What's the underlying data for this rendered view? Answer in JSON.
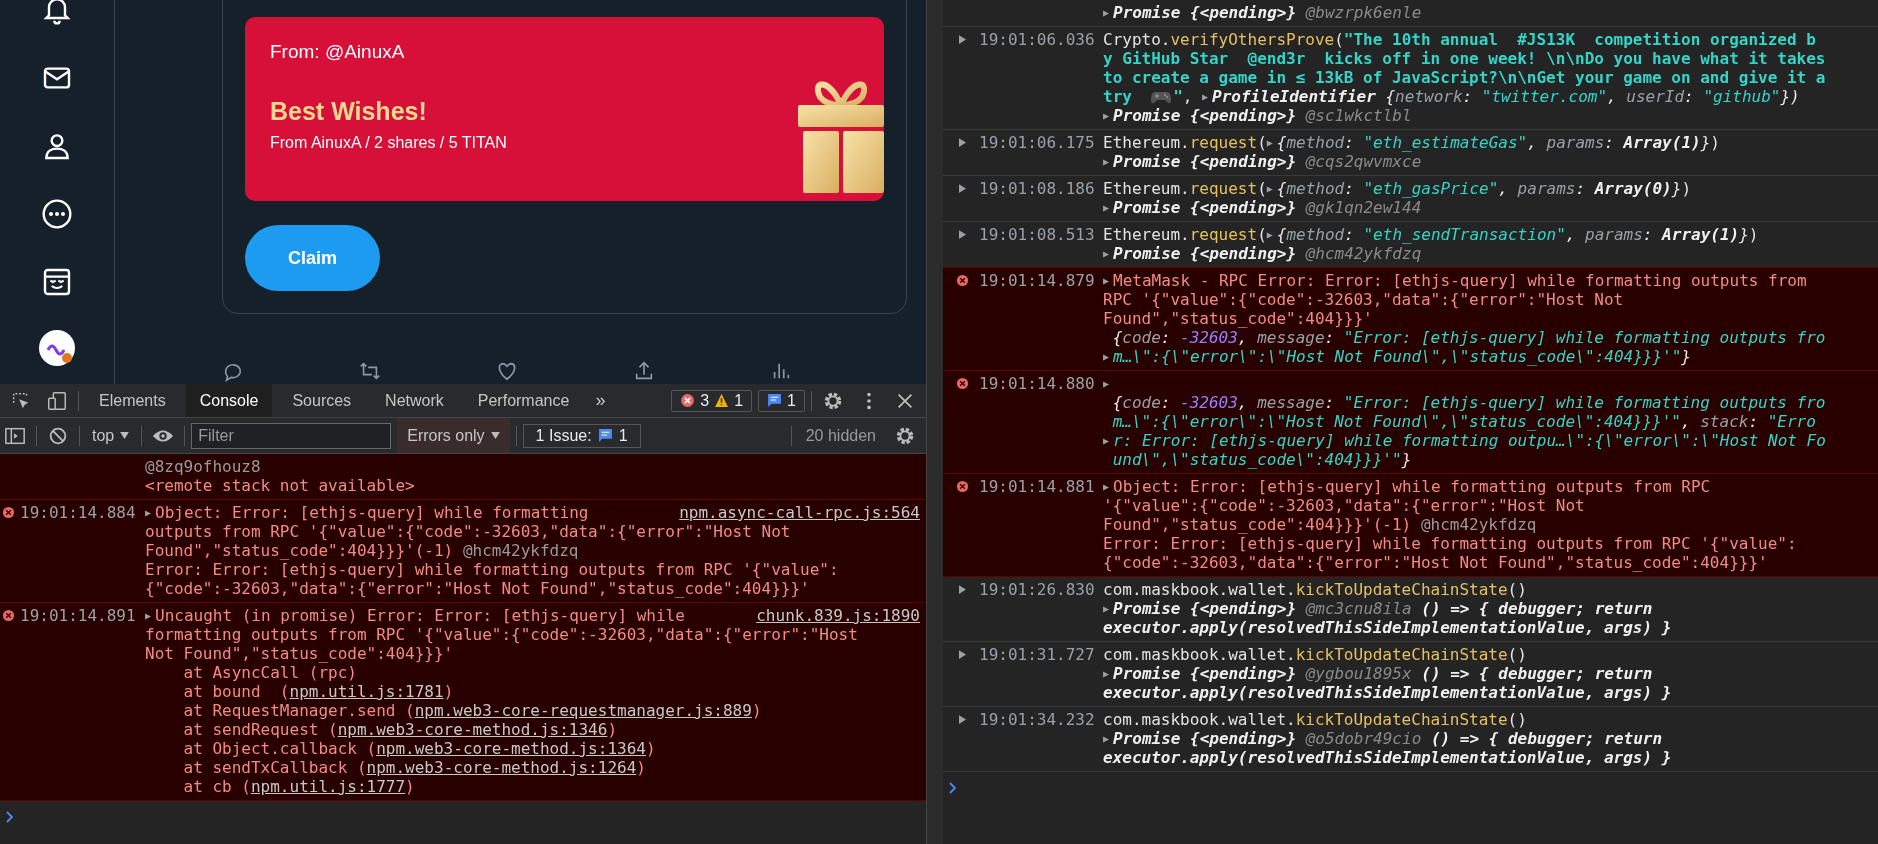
{
  "tweet_card": {
    "from": "From: @AinuxA",
    "title": "Best Wishes!",
    "subtitle": "From AinuxA / 2 shares / 5 TITAN",
    "button": "Claim"
  },
  "devtools": {
    "tabs": [
      {
        "label": "Elements",
        "selected": false
      },
      {
        "label": "Console",
        "selected": true
      },
      {
        "label": "Sources",
        "selected": false
      },
      {
        "label": "Network",
        "selected": false
      },
      {
        "label": "Performance",
        "selected": false
      }
    ],
    "more": "»",
    "errors": "3",
    "warnings": "1",
    "messages": "1"
  },
  "filter_bar": {
    "context": "top",
    "placeholder": "Filter",
    "levels": "Errors only",
    "issues_label": "1 Issue:",
    "issues_count": "1",
    "hidden": "20 hidden"
  },
  "left_console": {
    "messages": [
      {
        "kind": "error",
        "lines": [
          [
            {
              "kind": "dim",
              "text": "@8zq9ofhouz8"
            }
          ],
          [
            {
              "kind": "plain",
              "text": "<remote stack not available>"
            }
          ]
        ]
      },
      {
        "kind": "error",
        "time": "19:01:14.884",
        "source": "npm.async-call-rpc.js:564",
        "lines": [
          [
            {
              "kind": "arrow",
              "text": "▶"
            },
            {
              "kind": "plain",
              "text": "Object: Error: [ethjs-query] while formatting"
            }
          ],
          [
            {
              "kind": "plain",
              "text": "outputs from RPC '{\"value\":{\"code\":-32603,\"data\":{\"error\":\"Host Not"
            }
          ],
          [
            {
              "kind": "plain",
              "text": "Found\",\"status_code\":404}}}'(-1) "
            },
            {
              "kind": "dim",
              "text": "@hcm42ykfdzq"
            }
          ],
          [
            {
              "kind": "plain",
              "text": "Error: Error: [ethjs-query] while formatting outputs from RPC '{\"value\":"
            }
          ],
          [
            {
              "kind": "plain",
              "text": "{\"code\":-32603,\"data\":{\"error\":\"Host Not Found\",\"status_code\":404}}}'"
            }
          ]
        ]
      },
      {
        "kind": "error",
        "time": "19:01:14.891",
        "source": "chunk.839.js:1890",
        "lines": [
          [
            {
              "kind": "arrow",
              "text": "▶"
            },
            {
              "kind": "plain",
              "text": "Uncaught (in promise) Error: Error: [ethjs-query] while"
            }
          ],
          [
            {
              "kind": "plain",
              "text": "formatting outputs from RPC '{\"value\":{\"code\":-32603,\"data\":{\"error\":\"Host"
            }
          ],
          [
            {
              "kind": "plain",
              "text": "Not Found\",\"status_code\":404}}}'"
            }
          ],
          [
            {
              "kind": "plain",
              "text": "    at AsyncCall (rpc)"
            }
          ],
          [
            {
              "kind": "plain",
              "text": "    at bound  ("
            },
            {
              "kind": "link",
              "text": "npm.util.js:1781"
            },
            {
              "kind": "plain",
              "text": ")"
            }
          ],
          [
            {
              "kind": "plain",
              "text": "    at RequestManager.send ("
            },
            {
              "kind": "link",
              "text": "npm.web3-core-requestmanager.js:889"
            },
            {
              "kind": "plain",
              "text": ")"
            }
          ],
          [
            {
              "kind": "plain",
              "text": "    at sendRequest ("
            },
            {
              "kind": "link",
              "text": "npm.web3-core-method.js:1346"
            },
            {
              "kind": "plain",
              "text": ")"
            }
          ],
          [
            {
              "kind": "plain",
              "text": "    at Object.callback ("
            },
            {
              "kind": "link",
              "text": "npm.web3-core-method.js:1364"
            },
            {
              "kind": "plain",
              "text": ")"
            }
          ],
          [
            {
              "kind": "plain",
              "text": "    at sendTxCallback ("
            },
            {
              "kind": "link",
              "text": "npm.web3-core-method.js:1264"
            },
            {
              "kind": "plain",
              "text": ")"
            }
          ],
          [
            {
              "kind": "plain",
              "text": "    at cb ("
            },
            {
              "kind": "link",
              "text": "npm.util.js:1777"
            },
            {
              "kind": "plain",
              "text": ")"
            }
          ]
        ]
      }
    ]
  },
  "right_console": {
    "messages": [
      {
        "kind": "info",
        "lines": [
          [
            {
              "kind": "arrow",
              "text": "▶"
            },
            {
              "kind": "obj",
              "text": "Promise {<pending>}"
            },
            {
              "kind": "muted",
              "text": " @bwzrpk6enle"
            }
          ]
        ]
      },
      {
        "kind": "info",
        "time": "19:01:06.036",
        "lines": [
          [
            {
              "kind": "plain",
              "text": "Crypto."
            },
            {
              "kind": "fn",
              "text": "verifyOthersProve"
            },
            {
              "kind": "plain",
              "text": "("
            },
            {
              "kind": "str",
              "text": "\"The 10th annual  #JS13K  competition organized b"
            }
          ],
          [
            {
              "kind": "str",
              "text": "y GitHub Star  @end3r  kicks off in one week! \\n\\nDo you have what it takes"
            }
          ],
          [
            {
              "kind": "str",
              "text": "to create a game in ≤ 13kB of JavaScript?\\n\\nGet your game on and give it a"
            }
          ],
          [
            {
              "kind": "str",
              "text": "try  "
            },
            {
              "kind": "gamepad"
            },
            {
              "kind": "str",
              "text": "\""
            },
            {
              "kind": "plain",
              "text": ", "
            },
            {
              "kind": "arrow",
              "text": "▶"
            },
            {
              "kind": "obj",
              "text": "ProfileIdentifier"
            },
            {
              "kind": "ip",
              "text": " {"
            },
            {
              "kind": "key",
              "text": "network"
            },
            {
              "kind": "ip",
              "text": ": "
            },
            {
              "kind": "istr",
              "text": "\"twitter.com\""
            },
            {
              "kind": "ip",
              "text": ", "
            },
            {
              "kind": "key",
              "text": "userId"
            },
            {
              "kind": "ip",
              "text": ": "
            },
            {
              "kind": "istr",
              "text": "\"github\""
            },
            {
              "kind": "ip",
              "text": "})"
            }
          ],
          [
            {
              "kind": "arrow",
              "text": "▶"
            },
            {
              "kind": "obj",
              "text": "Promise {<pending>}"
            },
            {
              "kind": "muted",
              "text": " @sc1wkctlbl"
            }
          ]
        ]
      },
      {
        "kind": "info",
        "time": "19:01:06.175",
        "lines": [
          [
            {
              "kind": "plain",
              "text": "Ethereum."
            },
            {
              "kind": "fn",
              "text": "request"
            },
            {
              "kind": "plain",
              "text": "("
            },
            {
              "kind": "arrow",
              "text": "▶"
            },
            {
              "kind": "ip",
              "text": "{"
            },
            {
              "kind": "key",
              "text": "method"
            },
            {
              "kind": "ip",
              "text": ": "
            },
            {
              "kind": "istr",
              "text": "\"eth_estimateGas\""
            },
            {
              "kind": "ip",
              "text": ", "
            },
            {
              "kind": "key",
              "text": "params"
            },
            {
              "kind": "ip",
              "text": ": "
            },
            {
              "kind": "obj",
              "text": "Array(1)"
            },
            {
              "kind": "ip",
              "text": "}"
            },
            {
              "kind": "plain",
              "text": ")"
            }
          ],
          [
            {
              "kind": "arrow",
              "text": "▶"
            },
            {
              "kind": "obj",
              "text": "Promise {<pending>}"
            },
            {
              "kind": "muted",
              "text": " @cqs2qwvmxce"
            }
          ]
        ]
      },
      {
        "kind": "info",
        "time": "19:01:08.186",
        "lines": [
          [
            {
              "kind": "plain",
              "text": "Ethereum."
            },
            {
              "kind": "fn",
              "text": "request"
            },
            {
              "kind": "plain",
              "text": "("
            },
            {
              "kind": "arrow",
              "text": "▶"
            },
            {
              "kind": "ip",
              "text": "{"
            },
            {
              "kind": "key",
              "text": "method"
            },
            {
              "kind": "ip",
              "text": ": "
            },
            {
              "kind": "istr",
              "text": "\"eth_gasPrice\""
            },
            {
              "kind": "ip",
              "text": ", "
            },
            {
              "kind": "key",
              "text": "params"
            },
            {
              "kind": "ip",
              "text": ": "
            },
            {
              "kind": "obj",
              "text": "Array(0)"
            },
            {
              "kind": "ip",
              "text": "}"
            },
            {
              "kind": "plain",
              "text": ")"
            }
          ],
          [
            {
              "kind": "arrow",
              "text": "▶"
            },
            {
              "kind": "obj",
              "text": "Promise {<pending>}"
            },
            {
              "kind": "muted",
              "text": " @gk1qn2ew144"
            }
          ]
        ]
      },
      {
        "kind": "info",
        "time": "19:01:08.513",
        "lines": [
          [
            {
              "kind": "plain",
              "text": "Ethereum."
            },
            {
              "kind": "fn",
              "text": "request"
            },
            {
              "kind": "plain",
              "text": "("
            },
            {
              "kind": "arrow",
              "text": "▶"
            },
            {
              "kind": "ip",
              "text": "{"
            },
            {
              "kind": "key",
              "text": "method"
            },
            {
              "kind": "ip",
              "text": ": "
            },
            {
              "kind": "istr",
              "text": "\"eth_sendTransaction\""
            },
            {
              "kind": "ip",
              "text": ", "
            },
            {
              "kind": "key",
              "text": "params"
            },
            {
              "kind": "ip",
              "text": ": "
            },
            {
              "kind": "obj",
              "text": "Array(1)"
            },
            {
              "kind": "ip",
              "text": "}"
            },
            {
              "kind": "plain",
              "text": ")"
            }
          ],
          [
            {
              "kind": "arrow",
              "text": "▶"
            },
            {
              "kind": "obj",
              "text": "Promise {<pending>}"
            },
            {
              "kind": "muted",
              "text": " @hcm42ykfdzq"
            }
          ]
        ]
      },
      {
        "kind": "error",
        "time": "19:01:14.879",
        "lines": [
          [
            {
              "kind": "arrow",
              "text": "▶"
            },
            {
              "kind": "plain",
              "text": "MetaMask - RPC Error: Error: [ethjs-query] while formatting outputs from"
            }
          ],
          [
            {
              "kind": "plain",
              "text": "RPC '{\"value\":{\"code\":-32603,\"data\":{\"error\":\"Host Not"
            }
          ],
          [
            {
              "kind": "plain",
              "text": "Found\",\"status_code\":404}}}'"
            }
          ],
          [
            {
              "kind": "ip",
              "text": " {"
            },
            {
              "kind": "key",
              "text": "code"
            },
            {
              "kind": "ip",
              "text": ": "
            },
            {
              "kind": "num",
              "text": "-32603"
            },
            {
              "kind": "ip",
              "text": ", "
            },
            {
              "kind": "key",
              "text": "message"
            },
            {
              "kind": "ip",
              "text": ": "
            },
            {
              "kind": "istr",
              "text": "\"Error: [ethjs-query] while formatting outputs fro"
            }
          ],
          [
            {
              "kind": "arrow",
              "text": "▶"
            },
            {
              "kind": "istr",
              "text": "m…\\\":{\\\"error\\\":\\\"Host Not Found\\\",\\\"status_code\\\":404}}}'\""
            },
            {
              "kind": "ip",
              "text": "}"
            }
          ]
        ]
      },
      {
        "kind": "error",
        "time": "19:01:14.880",
        "lines": [
          [
            {
              "kind": "arrow",
              "text": "▶"
            }
          ],
          [
            {
              "kind": "ip",
              "text": " {"
            },
            {
              "kind": "key",
              "text": "code"
            },
            {
              "kind": "ip",
              "text": ": "
            },
            {
              "kind": "num",
              "text": "-32603"
            },
            {
              "kind": "ip",
              "text": ", "
            },
            {
              "kind": "key",
              "text": "message"
            },
            {
              "kind": "ip",
              "text": ": "
            },
            {
              "kind": "istr",
              "text": "\"Error: [ethjs-query] while formatting outputs fro"
            }
          ],
          [
            {
              "kind": "istr",
              "text": " m…\\\":{\\\"error\\\":\\\"Host Not Found\\\",\\\"status_code\\\":404}}}'\""
            },
            {
              "kind": "ip",
              "text": ", "
            },
            {
              "kind": "key",
              "text": "stack"
            },
            {
              "kind": "ip",
              "text": ": "
            },
            {
              "kind": "istr",
              "text": "\"Erro"
            }
          ],
          [
            {
              "kind": "arrow",
              "text": "▶"
            },
            {
              "kind": "istr",
              "text": "r: Error: [ethjs-query] while formatting outpu…\\\":{\\\"error\\\":\\\"Host Not Fo"
            }
          ],
          [
            {
              "kind": "istr",
              "text": " und\\\",\\\"status_code\\\":404}}}'\""
            },
            {
              "kind": "ip",
              "text": "}"
            }
          ]
        ]
      },
      {
        "kind": "error",
        "time": "19:01:14.881",
        "lines": [
          [
            {
              "kind": "arrow",
              "text": "▶"
            },
            {
              "kind": "plain",
              "text": "Object: Error: [ethjs-query] while formatting outputs from RPC"
            }
          ],
          [
            {
              "kind": "plain",
              "text": "'{\"value\":{\"code\":-32603,\"data\":{\"error\":\"Host Not"
            }
          ],
          [
            {
              "kind": "plain",
              "text": "Found\",\"status_code\":404}}}'(-1) "
            },
            {
              "kind": "dim",
              "text": "@hcm42ykfdzq"
            }
          ],
          [
            {
              "kind": "plain",
              "text": "Error: Error: [ethjs-query] while formatting outputs from RPC '{\"value\":"
            }
          ],
          [
            {
              "kind": "plain",
              "text": "{\"code\":-32603,\"data\":{\"error\":\"Host Not Found\",\"status_code\":404}}}'"
            }
          ]
        ]
      },
      {
        "kind": "info",
        "time": "19:01:26.830",
        "lines": [
          [
            {
              "kind": "plain",
              "text": "com.maskbook.wallet."
            },
            {
              "kind": "fn",
              "text": "kickToUpdateChainState"
            },
            {
              "kind": "plain",
              "text": "()"
            }
          ],
          [
            {
              "kind": "arrow",
              "text": "▶"
            },
            {
              "kind": "obj",
              "text": "Promise {<pending>}"
            },
            {
              "kind": "muted",
              "text": " @mc3cnu8ila"
            },
            {
              "kind": "obj",
              "text": " () => { debugger; return"
            }
          ],
          [
            {
              "kind": "obj",
              "text": "executor.apply(resolvedThisSideImplementationValue, args) }"
            }
          ]
        ]
      },
      {
        "kind": "info",
        "time": "19:01:31.727",
        "lines": [
          [
            {
              "kind": "plain",
              "text": "com.maskbook.wallet."
            },
            {
              "kind": "fn",
              "text": "kickToUpdateChainState"
            },
            {
              "kind": "plain",
              "text": "()"
            }
          ],
          [
            {
              "kind": "arrow",
              "text": "▶"
            },
            {
              "kind": "obj",
              "text": "Promise {<pending>}"
            },
            {
              "kind": "muted",
              "text": " @ygbou1895x"
            },
            {
              "kind": "obj",
              "text": " () => { debugger; return"
            }
          ],
          [
            {
              "kind": "obj",
              "text": "executor.apply(resolvedThisSideImplementationValue, args) }"
            }
          ]
        ]
      },
      {
        "kind": "info",
        "time": "19:01:34.232",
        "lines": [
          [
            {
              "kind": "plain",
              "text": "com.maskbook.wallet."
            },
            {
              "kind": "fn",
              "text": "kickToUpdateChainState"
            },
            {
              "kind": "plain",
              "text": "()"
            }
          ],
          [
            {
              "kind": "arrow",
              "text": "▶"
            },
            {
              "kind": "obj",
              "text": "Promise {<pending>}"
            },
            {
              "kind": "muted",
              "text": " @o5dobr49cio"
            },
            {
              "kind": "obj",
              "text": " () => { debugger; return"
            }
          ],
          [
            {
              "kind": "obj",
              "text": "executor.apply(resolvedThisSideImplementationValue, args) }"
            }
          ]
        ]
      }
    ]
  }
}
